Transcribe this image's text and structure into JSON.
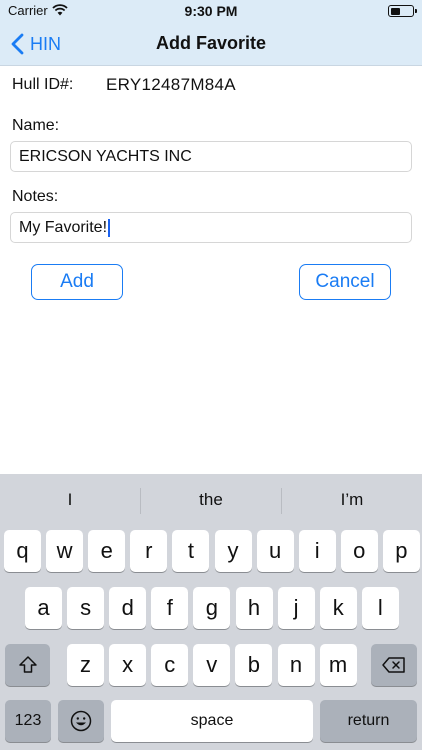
{
  "status_bar": {
    "carrier": "Carrier",
    "time": "9:30 PM"
  },
  "nav": {
    "back_label": "HIN",
    "title": "Add Favorite"
  },
  "form": {
    "hull_label": "Hull ID#:",
    "hull_value": "ERY12487M84A",
    "name_label": "Name:",
    "name_value": "ERICSON YACHTS INC",
    "notes_label": "Notes:",
    "notes_value": "My Favorite!",
    "add_label": "Add",
    "cancel_label": "Cancel"
  },
  "keyboard": {
    "suggestions": [
      "I",
      "the",
      "I’m"
    ],
    "row1": [
      "q",
      "w",
      "e",
      "r",
      "t",
      "y",
      "u",
      "i",
      "o",
      "p"
    ],
    "row2": [
      "a",
      "s",
      "d",
      "f",
      "g",
      "h",
      "j",
      "k",
      "l"
    ],
    "row3": [
      "z",
      "x",
      "c",
      "v",
      "b",
      "n",
      "m"
    ],
    "numbers_label": "123",
    "space_label": "space",
    "return_label": "return"
  },
  "colors": {
    "accent": "#1a7cf4",
    "nav_background": "#dcebf7",
    "keyboard_background": "#d2d5db"
  }
}
